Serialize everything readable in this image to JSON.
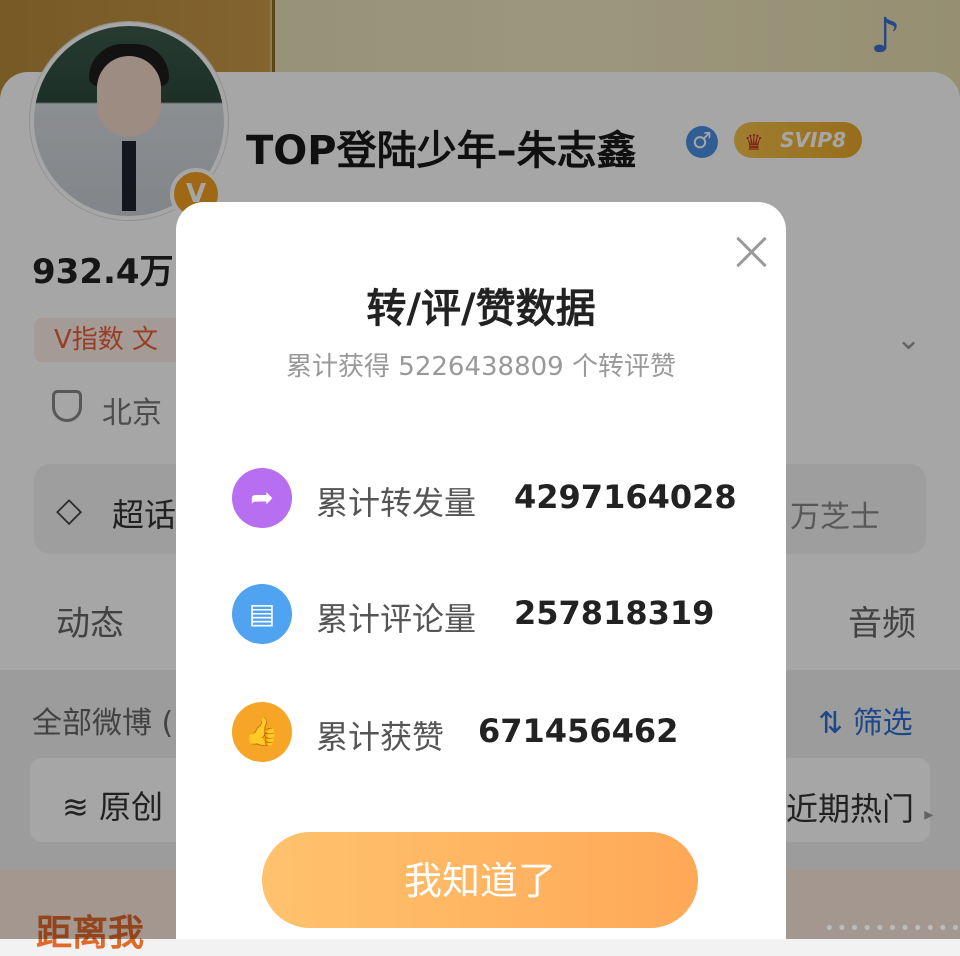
{
  "profile": {
    "username": "TOP登陆少年–朱志鑫",
    "gender_symbol": "♂",
    "vip_badge": "SVIP8",
    "verified_badge": "V",
    "followers": "932.4万",
    "v_index": "V指数 文",
    "location": "北京",
    "super_topic": "超话",
    "super_topic_right": "万芝士",
    "tab_left": "动态",
    "tab_right": "音频",
    "all_weibo": "全部微博 (",
    "filter_label": "筛选",
    "original_label": "原创",
    "hot_label": "近期热门",
    "bottom_text": "距离我"
  },
  "modal": {
    "title": "转/评/赞数据",
    "subtitle": "累计获得 5226438809 个转评赞",
    "stats": [
      {
        "label": "累计转发量",
        "value": "4297164028",
        "icon": "share-arrow-icon",
        "color": "#b86ef0"
      },
      {
        "label": "累计评论量",
        "value": "257818319",
        "icon": "comment-bubble-icon",
        "color": "#4fa3f0"
      },
      {
        "label": "累计获赞",
        "value": "671456462",
        "icon": "thumbs-up-icon",
        "color": "#f7a526"
      }
    ],
    "confirm_label": "我知道了"
  },
  "colors": {
    "accent_orange": "#ff9a2e",
    "link_blue": "#2a6fd6",
    "overlay": "rgba(0,0,0,0.35)"
  }
}
